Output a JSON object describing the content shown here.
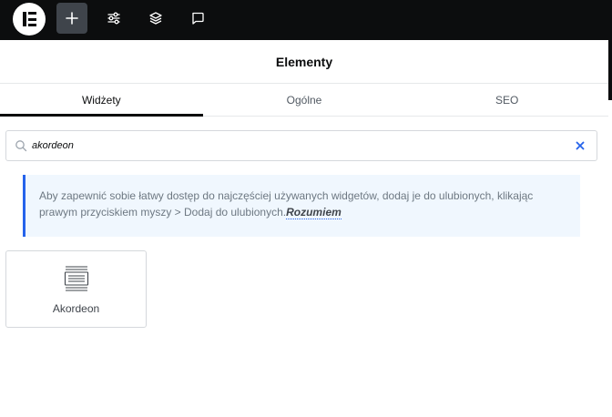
{
  "topbar": {
    "logo": "elementor-logo",
    "buttons": [
      {
        "name": "add-element-button",
        "icon": "plus-icon"
      },
      {
        "name": "site-settings-button",
        "icon": "sliders-icon"
      },
      {
        "name": "structure-button",
        "icon": "layers-icon"
      },
      {
        "name": "notes-button",
        "icon": "comment-icon"
      }
    ],
    "colors": {
      "background": "#0c0d0e",
      "active": "#3f444b"
    }
  },
  "panel": {
    "title": "Elementy",
    "tabs": [
      {
        "label": "Widżety",
        "active": true
      },
      {
        "label": "Ogólne",
        "active": false
      },
      {
        "label": "SEO",
        "active": false
      }
    ]
  },
  "search": {
    "value": "akordeon",
    "placeholder": ""
  },
  "notice": {
    "text": "Aby zapewnić sobie łatwy dostęp do najczęściej używanych widgetów, dodaj je do ulubionych, klikając prawym przyciskiem myszy > Dodaj do ulubionych.",
    "dismiss_label": "Rozumiem",
    "accent_color": "#2563eb"
  },
  "widgets": [
    {
      "label": "Akordeon",
      "icon": "accordion-icon"
    }
  ]
}
